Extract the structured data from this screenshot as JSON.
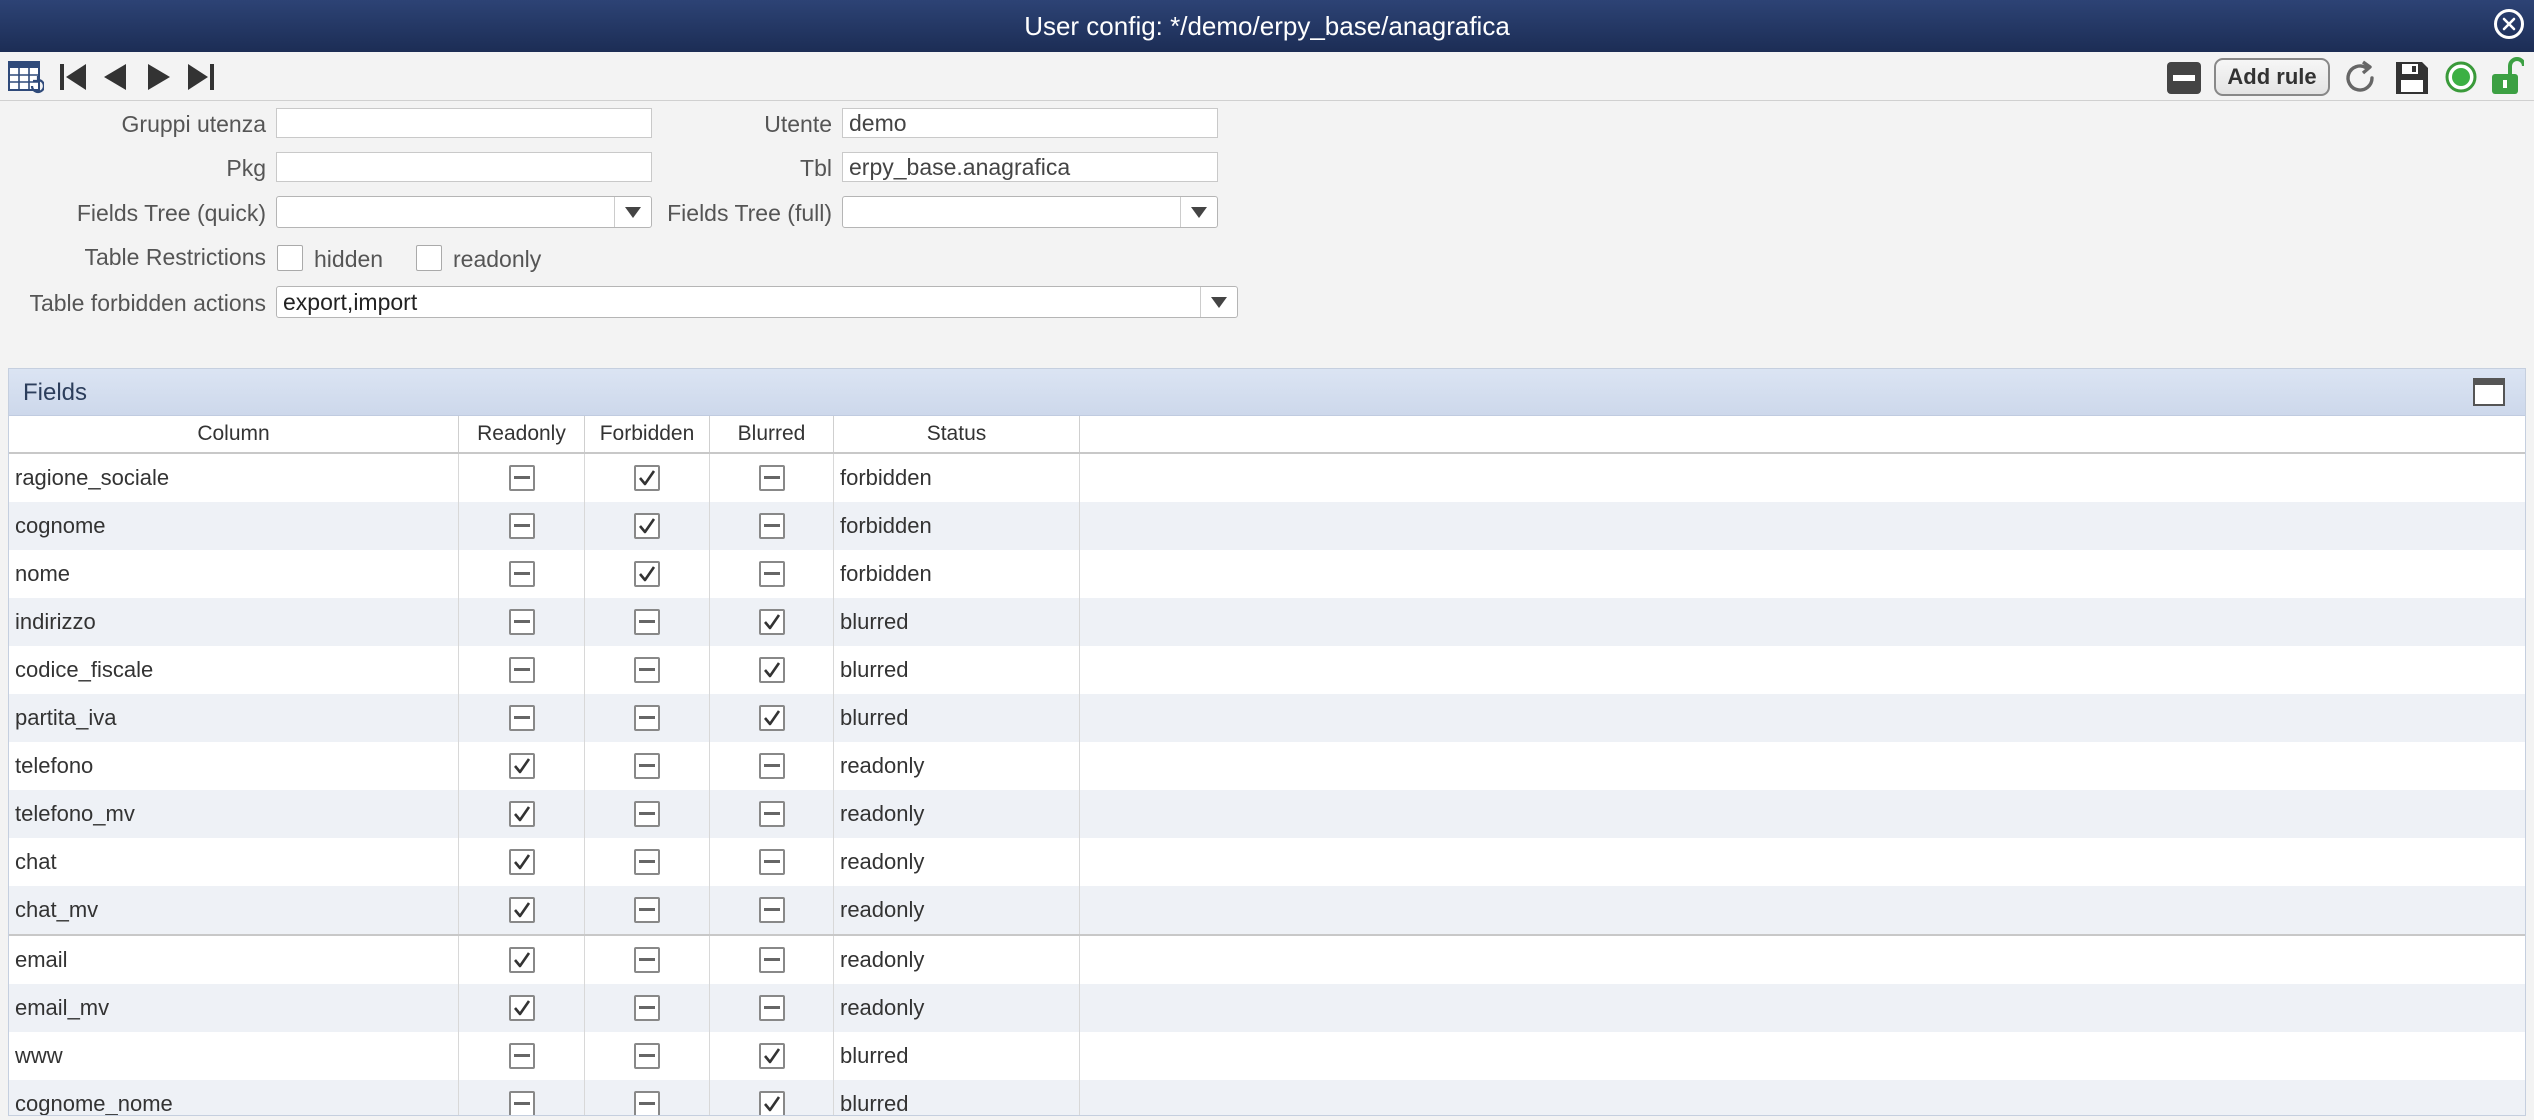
{
  "window": {
    "title": "User config: */demo/erpy_base/anagrafica"
  },
  "toolbar": {
    "icons": [
      "table-icon",
      "first-icon",
      "prev-icon",
      "next-icon",
      "last-icon"
    ],
    "right_icons": [
      "minus-icon",
      "refresh-icon",
      "save-icon",
      "status-dot-icon",
      "lock-icon"
    ],
    "add_rule_label": "Add rule"
  },
  "form": {
    "gruppi_utenza_label": "Gruppi utenza",
    "gruppi_utenza_value": "",
    "utente_label": "Utente",
    "utente_value": "demo",
    "pkg_label": "Pkg",
    "pkg_value": "",
    "tbl_label": "Tbl",
    "tbl_value": "erpy_base.anagrafica",
    "fields_tree_quick_label": "Fields Tree (quick)",
    "fields_tree_quick_value": "",
    "fields_tree_full_label": "Fields Tree (full)",
    "fields_tree_full_value": "",
    "table_restrictions_label": "Table Restrictions",
    "hidden_label": "hidden",
    "readonly_label": "readonly",
    "forbidden_actions_label": "Table forbidden actions",
    "forbidden_actions_value": "export,import"
  },
  "fields_panel": {
    "title": "Fields",
    "headers": {
      "column": "Column",
      "readonly": "Readonly",
      "forbidden": "Forbidden",
      "blurred": "Blurred",
      "status": "Status"
    },
    "rows": [
      {
        "column": "ragione_sociale",
        "readonly": false,
        "forbidden": true,
        "blurred": false,
        "status": "forbidden"
      },
      {
        "column": "cognome",
        "readonly": false,
        "forbidden": true,
        "blurred": false,
        "status": "forbidden"
      },
      {
        "column": "nome",
        "readonly": false,
        "forbidden": true,
        "blurred": false,
        "status": "forbidden"
      },
      {
        "column": "indirizzo",
        "readonly": false,
        "forbidden": false,
        "blurred": true,
        "status": "blurred"
      },
      {
        "column": "codice_fiscale",
        "readonly": false,
        "forbidden": false,
        "blurred": true,
        "status": "blurred"
      },
      {
        "column": "partita_iva",
        "readonly": false,
        "forbidden": false,
        "blurred": true,
        "status": "blurred"
      },
      {
        "column": "telefono",
        "readonly": true,
        "forbidden": false,
        "blurred": false,
        "status": "readonly"
      },
      {
        "column": "telefono_mv",
        "readonly": true,
        "forbidden": false,
        "blurred": false,
        "status": "readonly"
      },
      {
        "column": "chat",
        "readonly": true,
        "forbidden": false,
        "blurred": false,
        "status": "readonly"
      },
      {
        "column": "chat_mv",
        "readonly": true,
        "forbidden": false,
        "blurred": false,
        "status": "readonly"
      },
      {
        "column": "email",
        "readonly": true,
        "forbidden": false,
        "blurred": false,
        "status": "readonly"
      },
      {
        "column": "email_mv",
        "readonly": true,
        "forbidden": false,
        "blurred": false,
        "status": "readonly"
      },
      {
        "column": "www",
        "readonly": false,
        "forbidden": false,
        "blurred": true,
        "status": "blurred"
      },
      {
        "column": "cognome_nome",
        "readonly": false,
        "forbidden": false,
        "blurred": true,
        "status": "blurred"
      }
    ]
  }
}
